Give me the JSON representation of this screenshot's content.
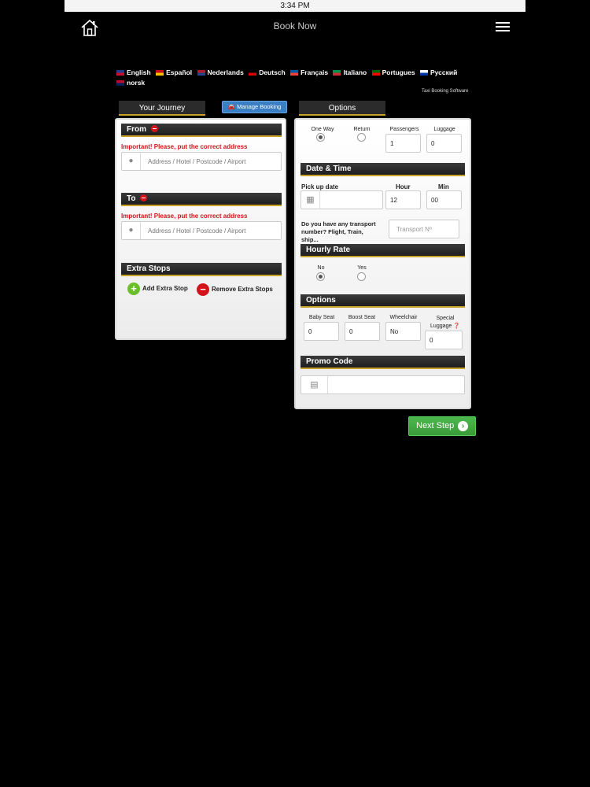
{
  "status_bar": {
    "time": "3:34 PM"
  },
  "header": {
    "title": "Book Now",
    "home_icon": "home-icon",
    "menu_icon": "hamburger-menu-icon"
  },
  "languages": [
    {
      "label": "English",
      "colors": [
        "#1f3d8c",
        "#c8102e"
      ]
    },
    {
      "label": "Español",
      "colors": [
        "#c60b1e",
        "#ffc400"
      ]
    },
    {
      "label": "Nederlands",
      "colors": [
        "#ae1c28",
        "#21468b"
      ]
    },
    {
      "label": "Deutsch",
      "colors": [
        "#000000",
        "#dd0000"
      ]
    },
    {
      "label": "Français",
      "colors": [
        "#0055a4",
        "#ef4135"
      ]
    },
    {
      "label": "Italiano",
      "colors": [
        "#009246",
        "#ce2b37"
      ]
    },
    {
      "label": "Portugues",
      "colors": [
        "#006600",
        "#ff0000"
      ]
    },
    {
      "label": "Русский",
      "colors": [
        "#ffffff",
        "#0039a6"
      ]
    },
    {
      "label": "norsk",
      "colors": [
        "#ba0c2f",
        "#00205b"
      ]
    }
  ],
  "software_label": "Taxi Booking Software",
  "tabs": {
    "journey": "Your Journey",
    "options": "Options",
    "manage_booking": "Manage Booking"
  },
  "journey": {
    "from_title": "From",
    "to_title": "To",
    "important_msg": "Important! Please, put the correct address",
    "address_placeholder": "Address / Hotel / Postcode / Airport",
    "extra_stops_title": "Extra Stops",
    "add_stop": "Add Extra Stop",
    "remove_stops": "Remove Extra Stops"
  },
  "options": {
    "one_way": "One Way",
    "return": "Return",
    "passengers_label": "Passengers",
    "passengers_value": "1",
    "luggage_label": "Luggage",
    "luggage_value": "0",
    "trip_selected": "one_way",
    "datetime_title": "Date & Time",
    "pickup_label": "Pick up date",
    "hour_label": "Hour",
    "hour_value": "12",
    "min_label": "Min",
    "min_value": "00",
    "transport_question": "Do you have any transport number? Flight, Train, ship...",
    "transport_placeholder": "Transport Nº",
    "hourly_title": "Hourly Rate",
    "hourly_no": "No",
    "hourly_yes": "Yes",
    "hourly_selected": "no",
    "extras_title": "Options",
    "baby_seat_label": "Baby Seat",
    "baby_seat_value": "0",
    "boost_seat_label": "Boost Seat",
    "boost_seat_value": "0",
    "wheelchair_label": "Wheelchair",
    "wheelchair_value": "No",
    "special_luggage_label": "Special Luggage",
    "special_luggage_value": "0",
    "promo_title": "Promo Code"
  },
  "next_step": "Next Step",
  "colors": {
    "accent_gold": "#c9a227",
    "next_green": "#3a9a3a",
    "manage_blue": "#3a7fc4",
    "warning_red": "#d4141c"
  }
}
